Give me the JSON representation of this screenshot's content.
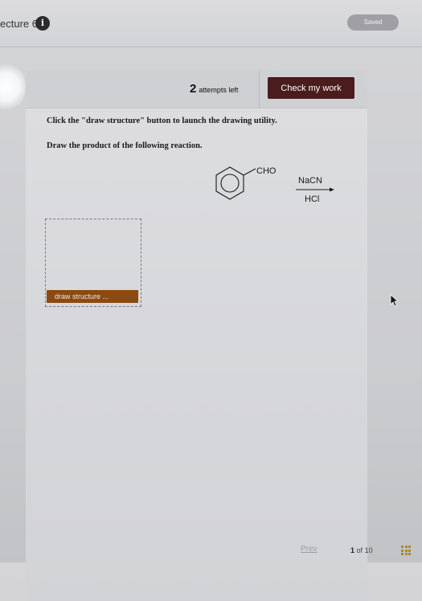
{
  "topbar": {
    "course_title": "ecture 6",
    "info_icon_glyph": "i",
    "saved_label": "Saved"
  },
  "card_header": {
    "attempts_count": "2",
    "attempts_label": "attempts left",
    "check_button_label": "Check my work"
  },
  "question": {
    "instruction_1": "Click the \"draw structure\" button to launch the drawing utility.",
    "instruction_2": "Draw the product of the following reaction."
  },
  "reaction": {
    "substituent": "CHO",
    "reagent_top": "NaCN",
    "reagent_bottom": "HCl"
  },
  "draw_area": {
    "button_label": "draw structure ..."
  },
  "footer": {
    "prev_label": "Prev",
    "current_page": "1",
    "of_label": "of",
    "total_pages": "10"
  },
  "colors": {
    "check_button": "#4a1c1c",
    "draw_button": "#8a4a12",
    "grid_icon": "#a88a25"
  },
  "icons": {
    "info": "info-icon",
    "cursor": "mouse-cursor-icon",
    "grid": "grid-icon"
  }
}
